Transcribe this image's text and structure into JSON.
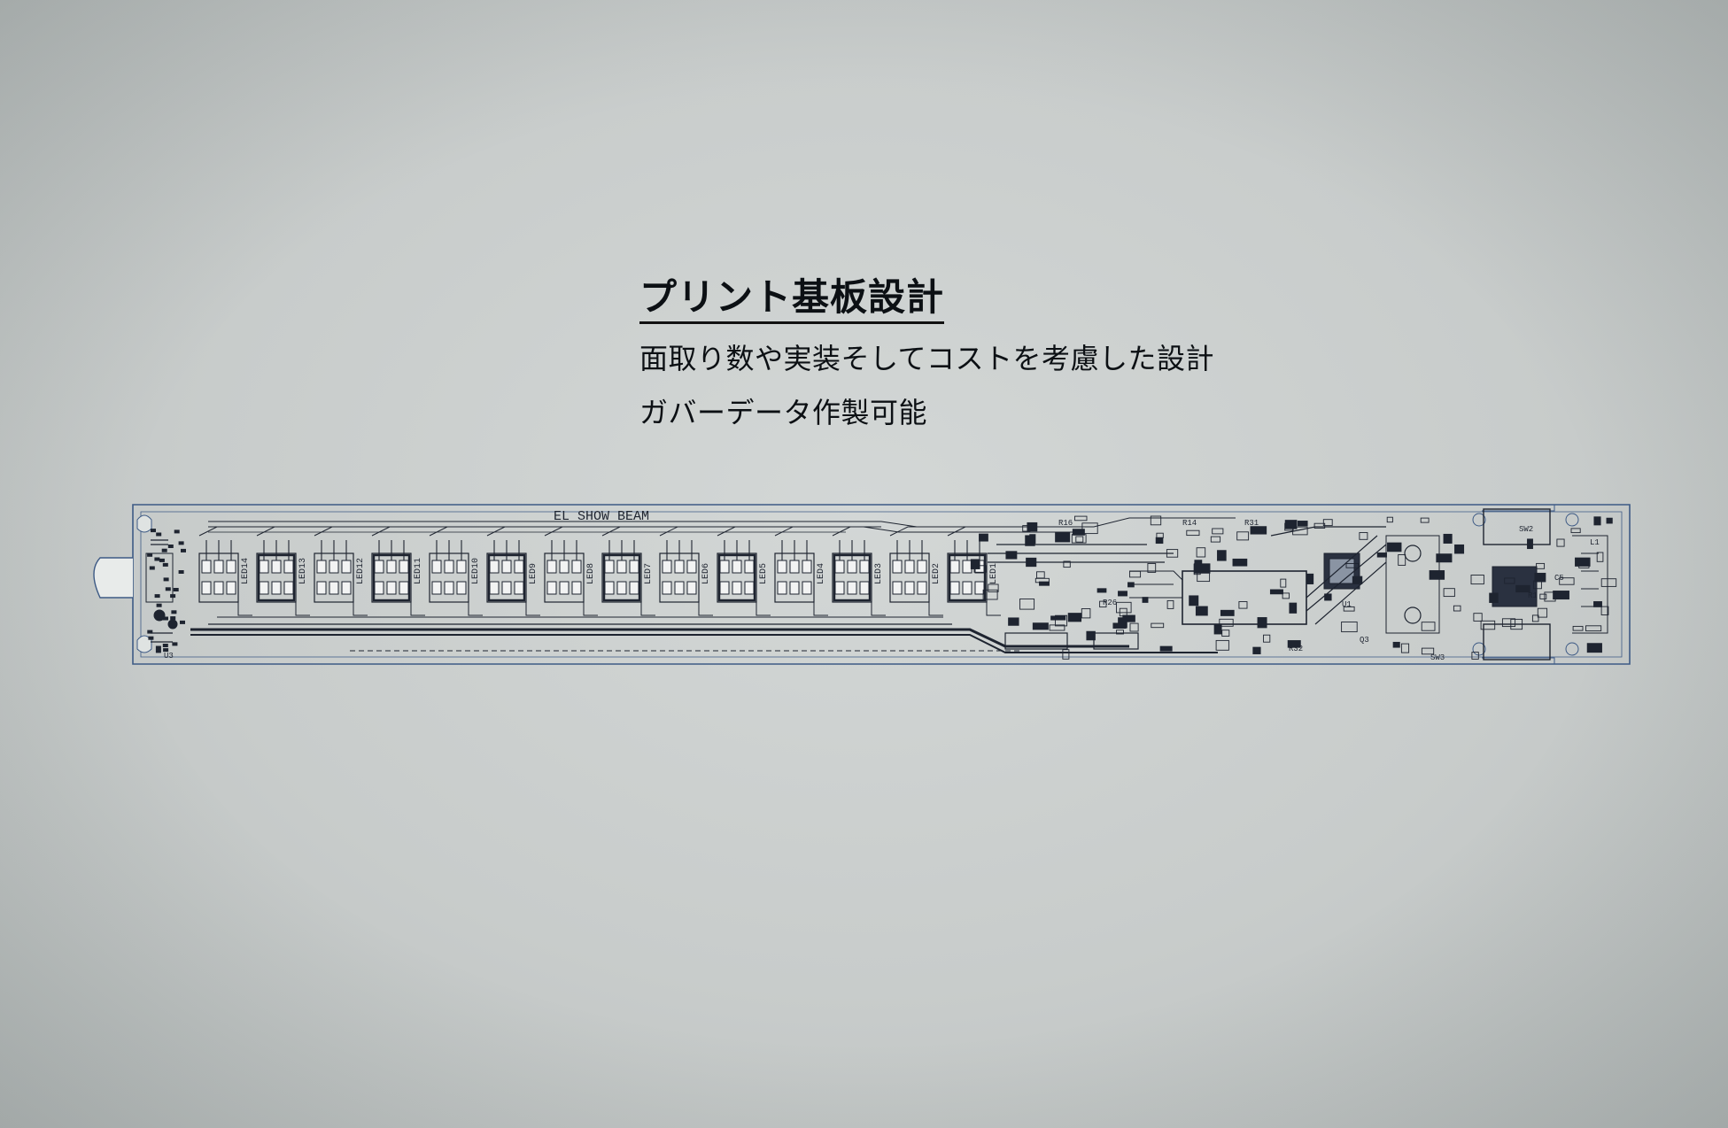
{
  "heading": {
    "title": "プリント基板設計",
    "line1": "面取り数や実装そしてコストを考慮した設計",
    "line2": "ガバーデータ作製可能"
  },
  "pcb": {
    "silkscreen_label": "EL SHOW BEAM",
    "led_labels": [
      "LED14",
      "LED13",
      "LED12",
      "LED11",
      "LED10",
      "LED9",
      "LED8",
      "LED7",
      "LED6",
      "LED5",
      "LED4",
      "LED3",
      "LED2",
      "LED1"
    ],
    "ref_labels": [
      "R16",
      "R14",
      "R26",
      "R32",
      "SW3",
      "SW2",
      "Q3",
      "L1",
      "U1",
      "U3",
      "R1",
      "R31",
      "C5"
    ],
    "colors": {
      "outline": "#3d5a85",
      "trace": "#1e2430",
      "pad": "#f2f3f3"
    }
  }
}
